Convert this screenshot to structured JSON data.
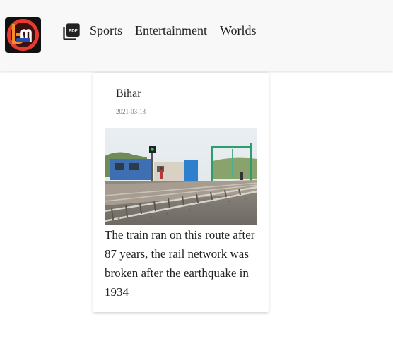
{
  "header": {
    "logo_icon": "bm-news-logo",
    "pdf_icon": "pdf-icon",
    "nav": [
      {
        "label": "Sports"
      },
      {
        "label": "Entertainment"
      },
      {
        "label": "Worlds"
      }
    ]
  },
  "card": {
    "category": "Bihar",
    "date": "2021-03-13",
    "image_icon": "railway-track-photo",
    "headline": "The train ran on this route after 87 years, the rail network was broken after the earthquake in 1934"
  },
  "colors": {
    "header_bg": "#f8f8f8",
    "logo_bg": "#111111",
    "logo_ring": "#e63c2f",
    "text": "#222222",
    "date": "#777777"
  }
}
